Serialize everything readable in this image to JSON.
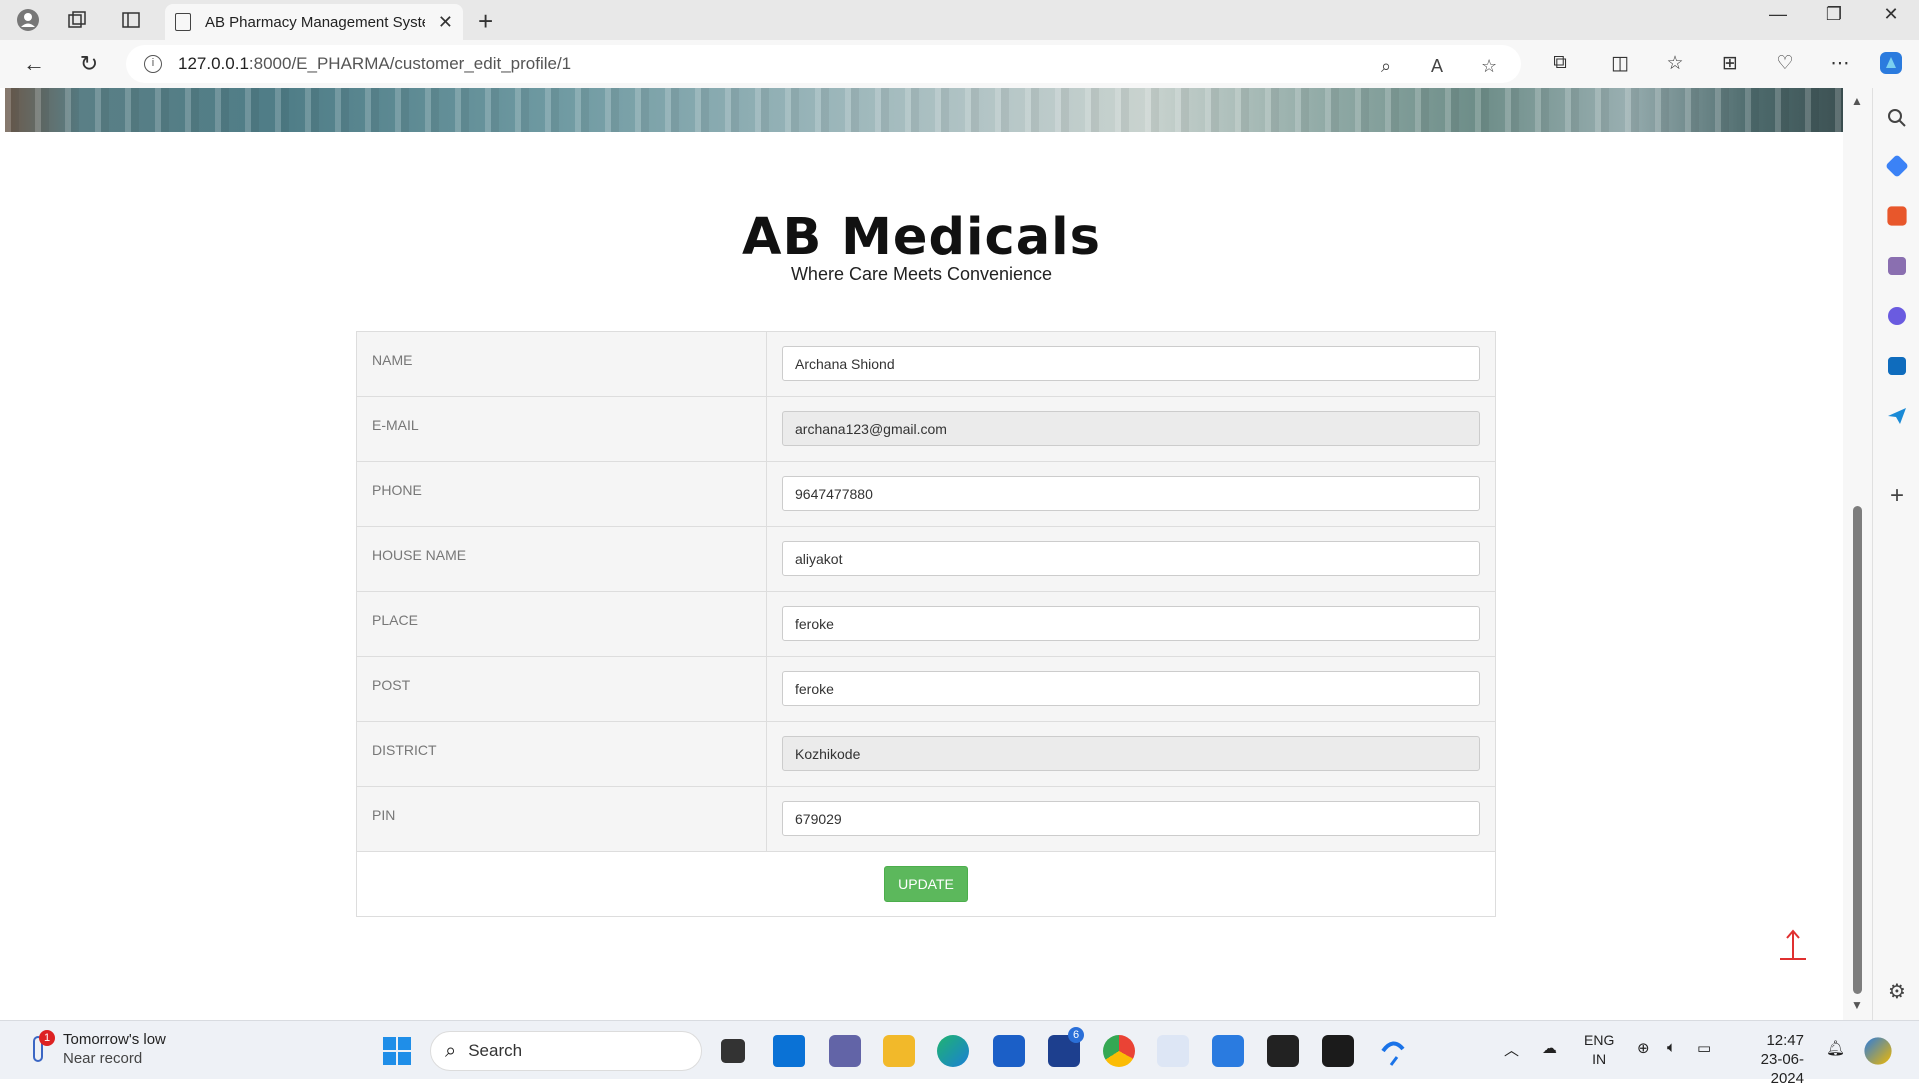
{
  "browser": {
    "tab_title": "AB Pharmacy Management Syste",
    "url_host": "127.0.0.1",
    "url_rest": ":8000/E_PHARMA/customer_edit_profile/1"
  },
  "site": {
    "brand_title": "AB Medicals",
    "tagline": "Where Care Meets Convenience"
  },
  "form": {
    "fields": [
      {
        "label": "NAME",
        "value": "Archana Shiond",
        "readonly": false
      },
      {
        "label": "E-MAIL",
        "value": "archana123@gmail.com",
        "readonly": true
      },
      {
        "label": "PHONE",
        "value": "9647477880",
        "readonly": false
      },
      {
        "label": "HOUSE NAME",
        "value": "aliyakot",
        "readonly": false
      },
      {
        "label": "PLACE",
        "value": "feroke",
        "readonly": false
      },
      {
        "label": "POST",
        "value": "feroke",
        "readonly": false
      },
      {
        "label": "DISTRICT",
        "value": "Kozhikode",
        "readonly": true
      },
      {
        "label": "PIN",
        "value": "679029",
        "readonly": false
      }
    ],
    "submit_label": "UPDATE"
  },
  "taskbar": {
    "weather_title": "Tomorrow's low",
    "weather_sub": "Near record",
    "weather_badge": "1",
    "search_placeholder": "Search",
    "mail_badge": "6",
    "lang_top": "ENG",
    "lang_bottom": "IN",
    "time": "12:47",
    "date": "23-06-2024"
  },
  "colors": {
    "update_button": "#5cb85c",
    "scroll_top_arrow": "#e03030"
  }
}
